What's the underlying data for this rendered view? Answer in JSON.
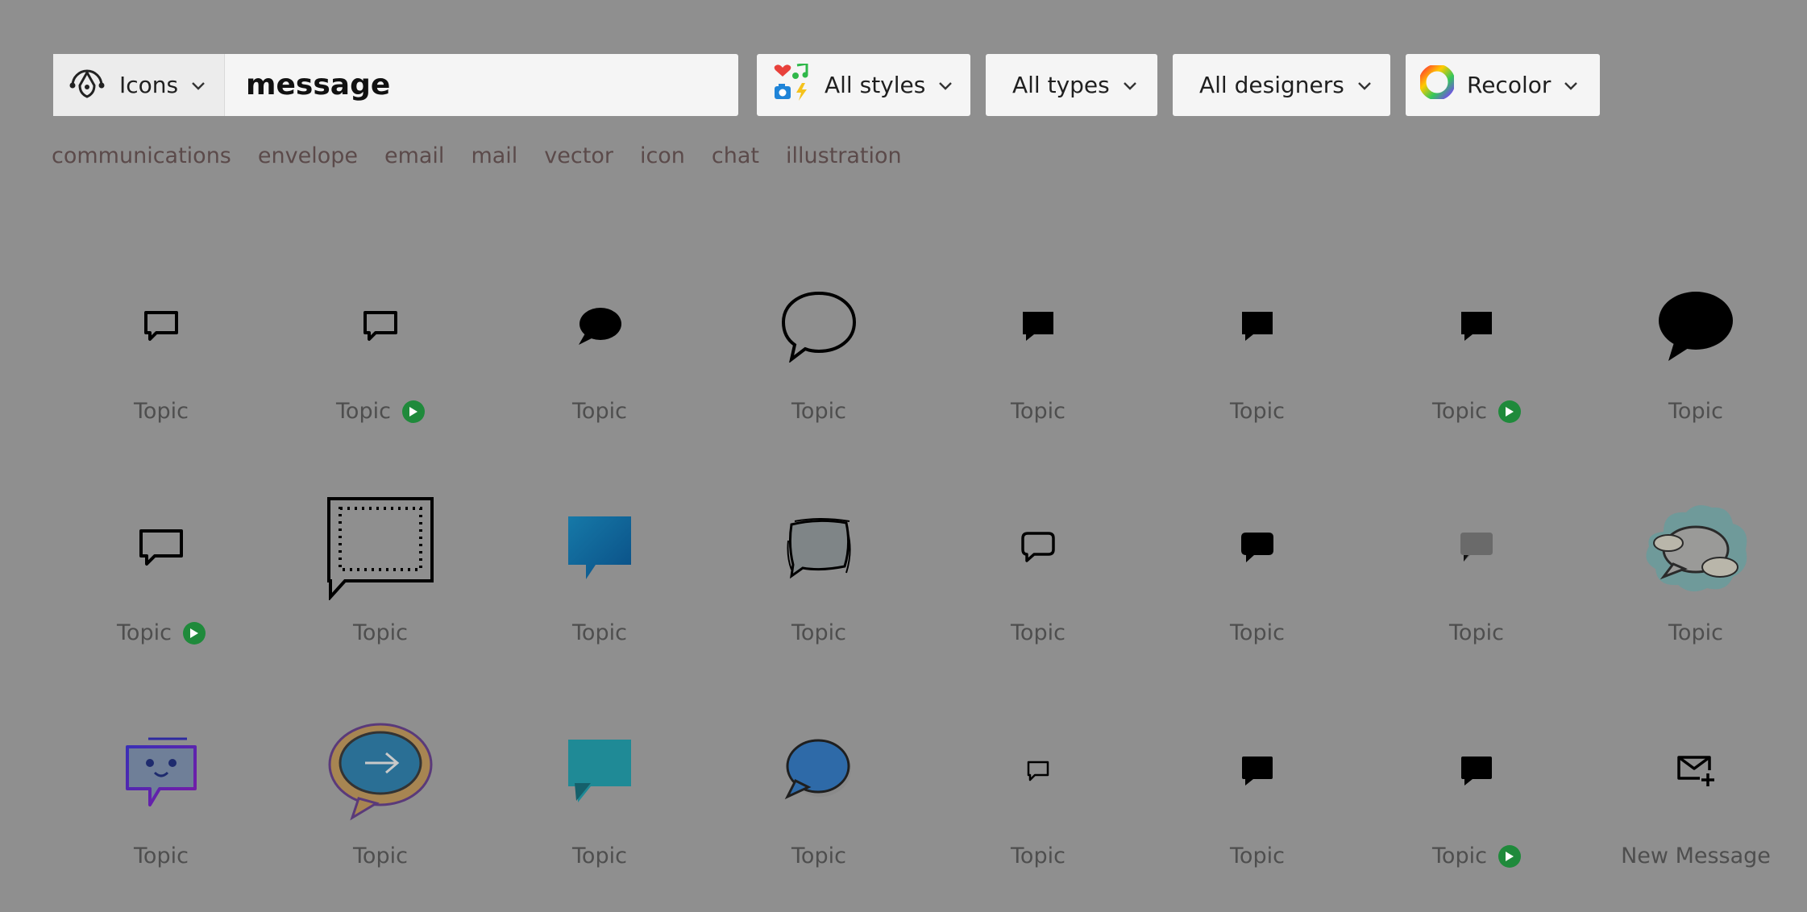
{
  "search": {
    "type_label": "Icons",
    "query": "message"
  },
  "filters": {
    "styles_label": "All styles",
    "types_label": "All types",
    "designers_label": "All designers",
    "recolor_label": "Recolor"
  },
  "related_terms": [
    "communications",
    "envelope",
    "email",
    "mail",
    "vector",
    "icon",
    "chat",
    "illustration"
  ],
  "results": [
    {
      "label": "Topic",
      "icon": "square-chat-outline-small-icon",
      "premium": false
    },
    {
      "label": "Topic",
      "icon": "square-chat-outline-small-icon",
      "premium": true
    },
    {
      "label": "Topic",
      "icon": "round-chat-solid-small-icon",
      "premium": false
    },
    {
      "label": "Topic",
      "icon": "round-chat-outline-large-icon",
      "premium": false
    },
    {
      "label": "Topic",
      "icon": "square-chat-solid-small-icon",
      "premium": false
    },
    {
      "label": "Topic",
      "icon": "square-chat-solid-small-icon",
      "premium": false
    },
    {
      "label": "Topic",
      "icon": "square-chat-solid-small-icon",
      "premium": true
    },
    {
      "label": "Topic",
      "icon": "round-chat-solid-large-icon",
      "premium": false
    },
    {
      "label": "Topic",
      "icon": "square-chat-outline-icon",
      "premium": true
    },
    {
      "label": "Topic",
      "icon": "dotted-frame-chat-icon",
      "premium": false
    },
    {
      "label": "Topic",
      "icon": "blue-gradient-chat-icon",
      "premium": false
    },
    {
      "label": "Topic",
      "icon": "sketchy-chat-icon",
      "premium": false
    },
    {
      "label": "Topic",
      "icon": "rounded-chat-outline-icon",
      "premium": false
    },
    {
      "label": "Topic",
      "icon": "rounded-chat-solid-icon",
      "premium": false
    },
    {
      "label": "Topic",
      "icon": "gray-chat-solid-icon",
      "premium": false
    },
    {
      "label": "Topic",
      "icon": "cloud-chat-bubbles-icon",
      "premium": false
    },
    {
      "label": "Topic",
      "icon": "smiling-chat-bot-icon",
      "premium": false
    },
    {
      "label": "Topic",
      "icon": "arrow-chat-bubble-icon",
      "premium": false
    },
    {
      "label": "Topic",
      "icon": "teal-chat-icon",
      "premium": false
    },
    {
      "label": "Topic",
      "icon": "blue-round-chat-icon",
      "premium": false
    },
    {
      "label": "Topic",
      "icon": "tiny-chat-outline-icon",
      "premium": false
    },
    {
      "label": "Topic",
      "icon": "square-chat-solid-small-icon",
      "premium": false
    },
    {
      "label": "Topic",
      "icon": "square-chat-solid-small-icon",
      "premium": true
    },
    {
      "label": "New Message",
      "icon": "new-message-envelope-icon",
      "premium": false
    }
  ],
  "colors": {
    "background": "#8f8f8f",
    "control_bg": "#f5f5f5",
    "premium_badge": "#1f8a3b"
  }
}
